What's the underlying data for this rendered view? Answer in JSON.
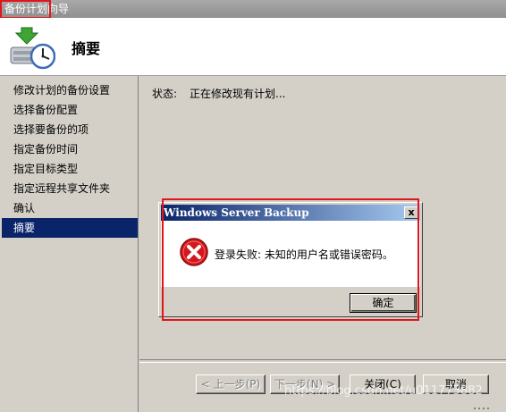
{
  "window": {
    "title": "备份计划向导"
  },
  "header": {
    "title": "摘要",
    "icon": "backup-schedule-icon"
  },
  "sidebar": {
    "items": [
      {
        "label": "修改计划的备份设置",
        "active": false
      },
      {
        "label": "选择备份配置",
        "active": false
      },
      {
        "label": "选择要备份的项",
        "active": false
      },
      {
        "label": "指定备份时间",
        "active": false
      },
      {
        "label": "指定目标类型",
        "active": false
      },
      {
        "label": "指定远程共享文件夹",
        "active": false
      },
      {
        "label": "确认",
        "active": false
      },
      {
        "label": "摘要",
        "active": true
      }
    ]
  },
  "main": {
    "status_label": "状态:",
    "status_value": "正在修改现有计划..."
  },
  "footer": {
    "prev_label": "< 上一步(P)",
    "next_label": "下一步(N) >",
    "close_label": "关闭(C)",
    "cancel_label": "取消"
  },
  "dialog": {
    "title": "Windows Server Backup",
    "close_glyph": "x",
    "message": "登录失败: 未知的用户名或错误密码。",
    "ok_label": "确定",
    "icon": "error-icon"
  },
  "watermark": {
    "text": "https://blog.csdn.net/u011775882"
  },
  "colors": {
    "selection": "#0a246a",
    "dialog_title_gradient_start": "#0a246a",
    "dialog_title_gradient_end": "#a6caf0",
    "annotation_red": "#e0161b",
    "error_red": "#d4171c"
  }
}
